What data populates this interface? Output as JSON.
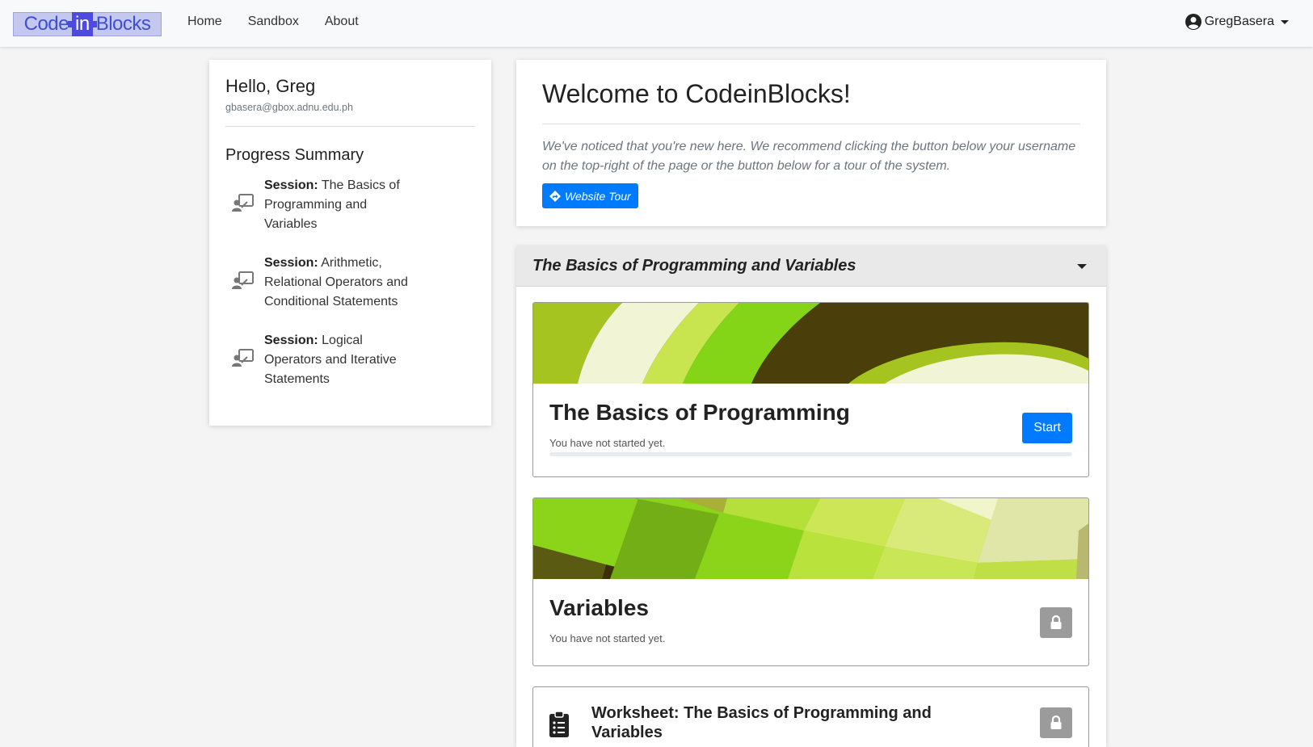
{
  "navbar": {
    "logo": {
      "part1": "Code",
      "part2": "in",
      "part3": "Blocks"
    },
    "links": [
      "Home",
      "Sandbox",
      "About"
    ],
    "username": "GregBasera"
  },
  "profile": {
    "greeting": "Hello, Greg",
    "email": "gbasera@gbox.adnu.edu.ph",
    "progress_title": "Progress Summary",
    "session_prefix": "Session:",
    "sessions": [
      {
        "name": "The Basics of Programming and Variables"
      },
      {
        "name": "Arithmetic, Relational Operators and Conditional Statements"
      },
      {
        "name": "Logical Operators and Iterative Statements"
      }
    ]
  },
  "welcome": {
    "title": "Welcome to CodeinBlocks!",
    "text": "We've noticed that you're new here. We recommend clicking the button below your username on the top-right of the page or the button below for a tour of the system.",
    "tour_button": "Website Tour"
  },
  "session_section": {
    "title": "The Basics of Programming and Variables",
    "lessons": [
      {
        "title": "The Basics of Programming",
        "status": "You have not started yet.",
        "button": "Start",
        "progress": 0
      },
      {
        "title": "Variables",
        "status": "You have not started yet.",
        "locked": true
      }
    ],
    "worksheet": {
      "title": "Worksheet: The Basics of Programming and Variables",
      "locked": true
    }
  },
  "colors": {
    "primary": "#007bff",
    "locked": "#9b9b9b",
    "logo_accent": "#4e4ae0"
  }
}
